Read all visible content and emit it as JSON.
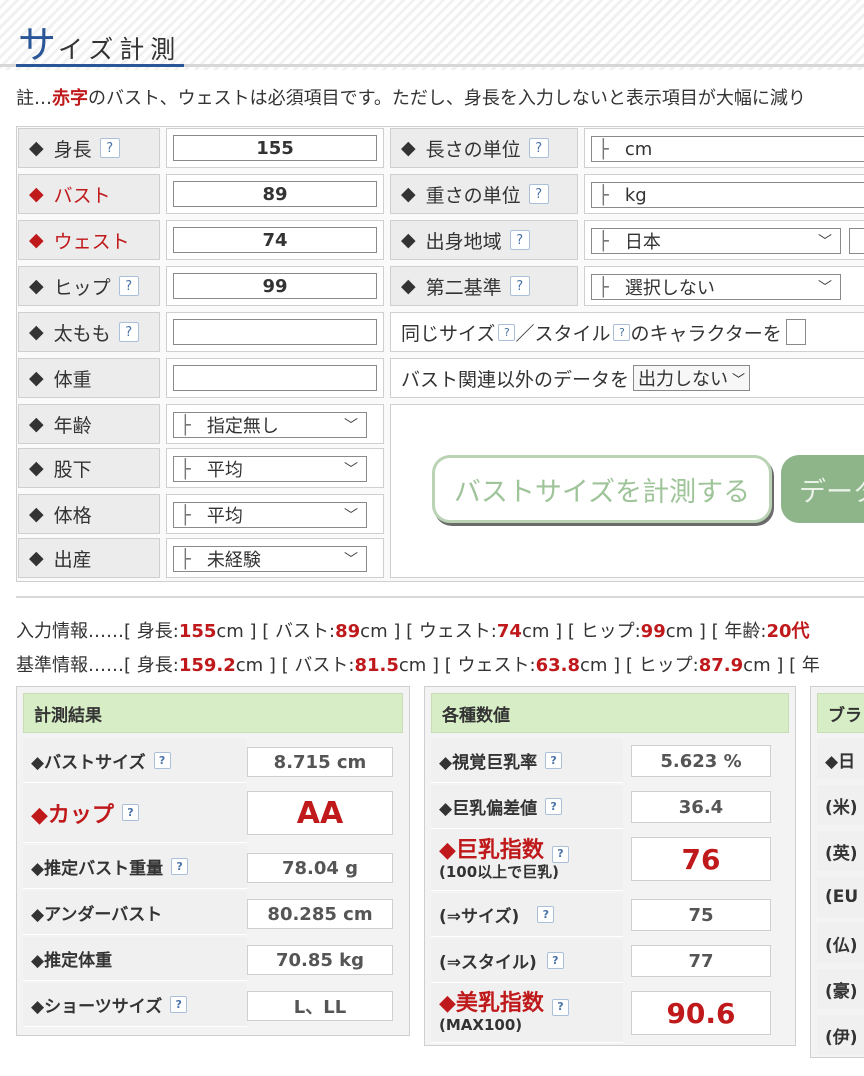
{
  "title": {
    "first_char": "サ",
    "rest": "イズ計測"
  },
  "note": {
    "prefix": "註…",
    "red_word": "赤字",
    "suffix": "のバスト、ウェストは必須項目です。ただし、身長を入力しないと表示項目が大幅に減り"
  },
  "form": {
    "help": "?",
    "diamond": "◆",
    "height": {
      "label": "身長",
      "value": "155"
    },
    "bust": {
      "label": "バスト",
      "value": "89"
    },
    "waist": {
      "label": "ウェスト",
      "value": "74"
    },
    "hip": {
      "label": "ヒップ",
      "value": "99"
    },
    "thigh": {
      "label": "太もも",
      "value": ""
    },
    "weight": {
      "label": "体重",
      "value": ""
    },
    "age": {
      "label": "年齢",
      "value": "指定無し"
    },
    "inseam": {
      "label": "股下",
      "value": "平均"
    },
    "build": {
      "label": "体格",
      "value": "平均"
    },
    "birth": {
      "label": "出産",
      "value": "未経験"
    },
    "length_unit": {
      "label": "長さの単位",
      "value": "cm"
    },
    "weight_unit": {
      "label": "重さの単位",
      "value": "kg"
    },
    "origin": {
      "label": "出身地域",
      "value": "日本"
    },
    "second_std": {
      "label": "第二基準",
      "value": "選択しない"
    },
    "select_bar": "├",
    "chevron": "﹀",
    "same_size": {
      "part1": "同じサイズ",
      "part2": "／スタイル",
      "part3": "のキャラクターを"
    },
    "non_bust": {
      "text": "バスト関連以外のデータを",
      "value": "出力しない"
    },
    "measure_button": "バストサイズを計測する",
    "data_button": "データ"
  },
  "input_info": {
    "prefix": "入力情報……[ 身長:",
    "height": "155",
    "u1": "cm ] [ バスト:",
    "bust": "89",
    "u2": "cm ] [ ウェスト:",
    "waist": "74",
    "u3": "cm ] [ ヒップ:",
    "hip": "99",
    "u4": "cm ] [ 年齢:",
    "age": "20代"
  },
  "base_info": {
    "prefix": "基準情報……[ 身長:",
    "height": "159.2",
    "u1": "cm ] [ バスト:",
    "bust": "81.5",
    "u2": "cm ] [ ウェスト:",
    "waist": "63.8",
    "u3": "cm ] [ ヒップ:",
    "hip": "87.9",
    "u4": "cm ] [ 年"
  },
  "results": {
    "title": "計測結果",
    "rows": [
      {
        "label": "◆バストサイズ",
        "value": "8.715 cm"
      },
      {
        "label": "◆カップ",
        "value": "AA"
      },
      {
        "label": "◆推定バスト重量",
        "value": "78.04 g"
      },
      {
        "label": "◆アンダーバスト",
        "value": "80.285 cm"
      },
      {
        "label": "◆推定体重",
        "value": "70.85 kg"
      },
      {
        "label": "◆ショーツサイズ",
        "value": "L、LL"
      }
    ]
  },
  "values": {
    "title": "各種数値",
    "rows": [
      {
        "label": "◆視覚巨乳率",
        "value": "5.623 %"
      },
      {
        "label": "◆巨乳偏差値",
        "value": "36.4"
      },
      {
        "label": "◆巨乳指数",
        "sub": "(100以上で巨乳)",
        "value": "76"
      },
      {
        "label": "(⇒サイズ)",
        "value": "75"
      },
      {
        "label": "(⇒スタイル)",
        "value": "77"
      },
      {
        "label": "◆美乳指数",
        "sub": "(MAX100)",
        "value": "90.6"
      }
    ]
  },
  "bra": {
    "title": "ブラ",
    "rows": [
      "◆日",
      "(米)",
      "(英)",
      "(EU",
      "(仏)",
      "(豪)",
      "(伊)"
    ]
  }
}
